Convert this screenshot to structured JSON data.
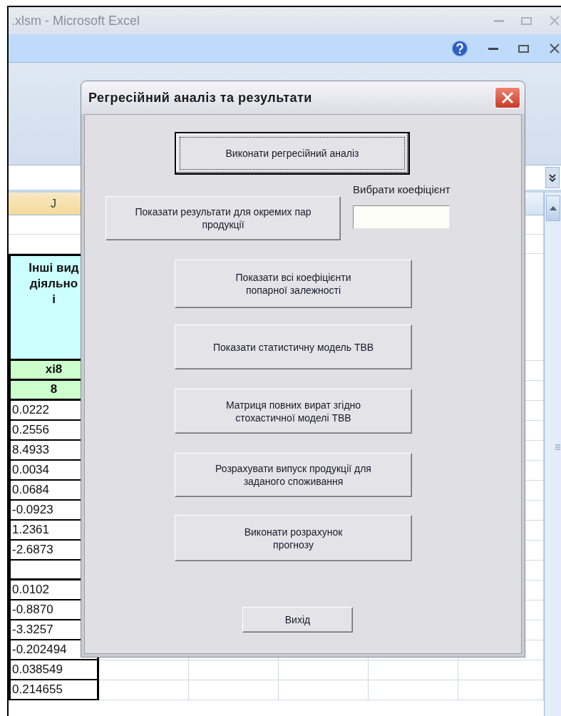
{
  "window": {
    "title": ".xlsm - Microsoft Excel"
  },
  "sheet": {
    "columns": [
      "J"
    ],
    "rows": [
      {
        "kind": "blank"
      },
      {
        "kind": "blank"
      },
      {
        "kind": "header",
        "text": "Інші вид\nдіяльно\nі"
      },
      {
        "kind": "label",
        "text": "xi8"
      },
      {
        "kind": "label",
        "text": "8"
      },
      {
        "kind": "number",
        "text": "0.0222"
      },
      {
        "kind": "number",
        "text": "0.2556"
      },
      {
        "kind": "number",
        "text": "8.4933"
      },
      {
        "kind": "number",
        "text": "0.0034"
      },
      {
        "kind": "number",
        "text": "0.0684"
      },
      {
        "kind": "number",
        "text": "-0.0923"
      },
      {
        "kind": "number",
        "text": "1.2361"
      },
      {
        "kind": "number",
        "text": "-2.6873"
      },
      {
        "kind": "gap"
      },
      {
        "kind": "number",
        "text": "0.0102"
      },
      {
        "kind": "number",
        "text": "-0.8870"
      },
      {
        "kind": "number",
        "text": "-3.3257"
      },
      {
        "kind": "number",
        "text": "-0.202494"
      },
      {
        "kind": "number",
        "text": "0.038549"
      },
      {
        "kind": "number",
        "text": "0.214655"
      }
    ]
  },
  "dialog": {
    "title": "Регресійний аналіз та результати",
    "buttons": [
      {
        "label": "Виконати регресійний аналіз",
        "default": true
      },
      {
        "label": "Показати результати для окремих пар продукції",
        "default": false
      },
      {
        "label": "Показати всі коефіцієнти попарної залежності",
        "default": false
      },
      {
        "label": "Показати статистичну модель ТВВ",
        "default": false
      },
      {
        "label": "Матриця повних вират згідно стохастичної моделі ТВВ",
        "default": false
      },
      {
        "label": "Розрахувати випуск продукції для заданого споживання",
        "default": false
      },
      {
        "label": "Виконати розрахунок прогнозу",
        "default": false
      },
      {
        "label": "Вихід",
        "default": false
      }
    ],
    "coefficient": {
      "label": "Вибрати коефіцієнт"
    }
  }
}
